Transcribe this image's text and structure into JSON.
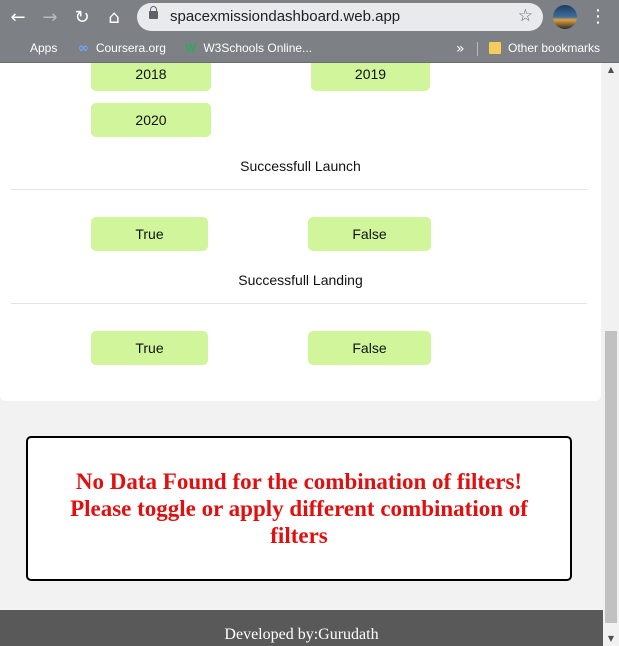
{
  "browser": {
    "url": "spacexmissiondashboard.web.app",
    "icons": {
      "back": "back-arrow-icon",
      "forward": "forward-arrow-icon",
      "reload": "reload-icon",
      "home": "home-icon",
      "lock": "lock-icon",
      "star": "star-icon",
      "menu": "menu-icon"
    },
    "bookmarks": [
      {
        "label": "Apps",
        "icon": "apps-grid-icon"
      },
      {
        "label": "Coursera.org",
        "icon": "coursera-icon"
      },
      {
        "label": "W3Schools Online...",
        "icon": "w3schools-icon"
      }
    ],
    "overflow_chevron": "»",
    "other_bookmarks": "Other bookmarks"
  },
  "filters": {
    "years": [
      "2018",
      "2019",
      "2020"
    ],
    "launch": {
      "title": "Successfull Launch",
      "options": [
        "True",
        "False"
      ]
    },
    "landing": {
      "title": "Successfull Landing",
      "options": [
        "True",
        "False"
      ]
    },
    "button_color": "#d0f59a"
  },
  "message": {
    "lines": [
      "No Data Found for the combination of filters!",
      "Please toggle or apply different combination of",
      "filters"
    ],
    "color": "#e11010"
  },
  "footer": {
    "text": "Developed by:Gurudath"
  }
}
